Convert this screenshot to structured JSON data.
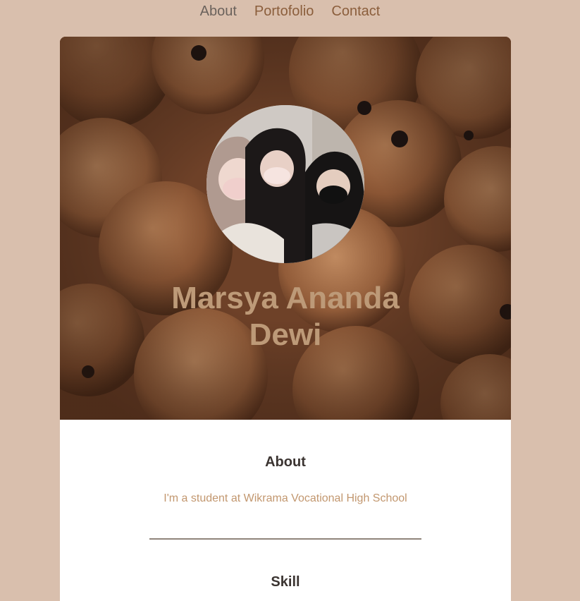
{
  "nav": {
    "items": [
      {
        "label": "About"
      },
      {
        "label": "Portofolio"
      },
      {
        "label": "Contact"
      }
    ]
  },
  "hero": {
    "name": "Marsya Ananda Dewi",
    "background": "teddy-bear-pattern",
    "avatar": "profile-photo"
  },
  "about": {
    "title": "About",
    "text": "I'm a student at Wikrama Vocational High School"
  },
  "skill": {
    "title": "Skill"
  },
  "colors": {
    "page_bg": "#d9bfad",
    "nav_link": "#8b5e3c",
    "name": "#bd9a78",
    "accent_text": "#c2976f",
    "heading": "#3b3431"
  }
}
